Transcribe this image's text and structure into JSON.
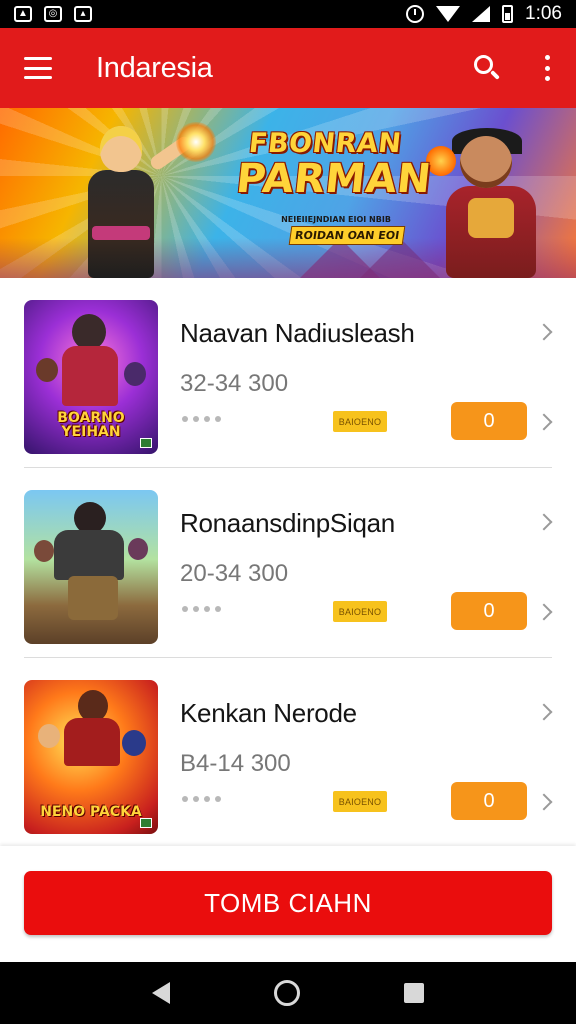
{
  "status_bar": {
    "time": "1:06",
    "left_icons": [
      "image-icon",
      "app-icon",
      "app-icon-2"
    ],
    "right_icons": [
      "alarm-icon",
      "wifi-icon",
      "signal-icon",
      "battery-icon"
    ]
  },
  "app_bar": {
    "title": "Indaresia",
    "icons": [
      "menu-icon",
      "search-icon",
      "more-vert-icon"
    ],
    "color": "#e11b1b"
  },
  "banner": {
    "title_line1": "FBONRAN",
    "title_line2": "PARMAN",
    "subtitle": "NEIEIIEJNDIAN EIOI NBIB",
    "tag": "ROIDAN OAN EOI"
  },
  "items": [
    {
      "title": "Naavan Nadiusleash",
      "price": "32-34 300",
      "badge": "BAIOENO",
      "count": "0",
      "thumb_text": "BOARNO YEIHAN"
    },
    {
      "title": "RonaansdinpSiqan",
      "price": "20-34 300",
      "badge": "BAIOENO",
      "count": "0",
      "thumb_text": ""
    },
    {
      "title": "Kenkan Nerode",
      "price": "B4-14 300",
      "badge": "BAIOENO",
      "count": "0",
      "thumb_text": "NENO PACKA"
    }
  ],
  "cta": {
    "label": "TOMB CIAHN",
    "color": "#ea0d0d"
  },
  "accent_colors": {
    "count_button": "#f6951a",
    "badge": "#f7c21d"
  },
  "nav_bar": {
    "icons": [
      "back-icon",
      "home-icon",
      "recents-icon"
    ]
  }
}
